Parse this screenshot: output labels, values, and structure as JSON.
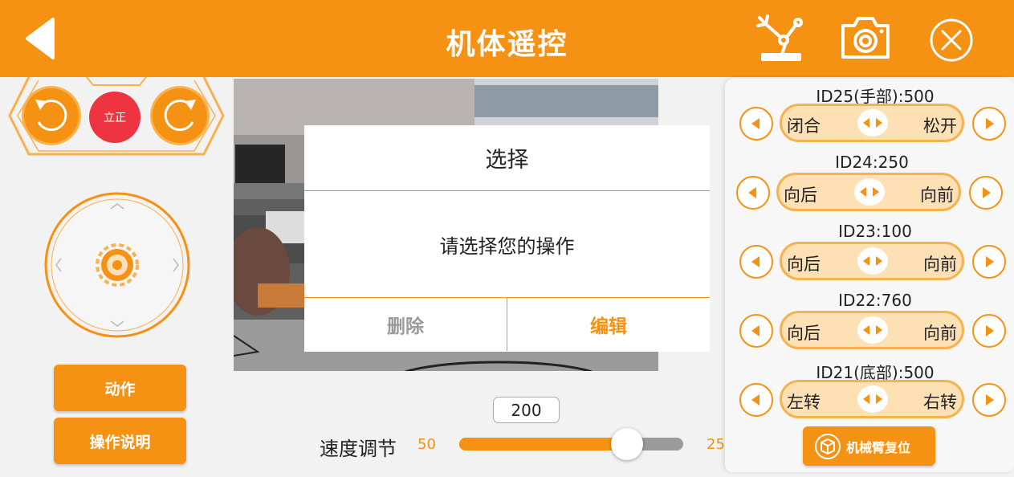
{
  "header": {
    "title": "机体遥控",
    "icons": [
      "back-arrow-icon",
      "robot-arm-icon",
      "camera-icon",
      "close-icon"
    ]
  },
  "left_panel": {
    "upright_label": "立正",
    "action_label": "动作",
    "instructions_label": "操作说明"
  },
  "dialog": {
    "title": "选择",
    "message": "请选择您的操作",
    "delete_label": "删除",
    "edit_label": "编辑"
  },
  "speed": {
    "label": "速度调节",
    "value": "200",
    "min_label": "50",
    "max_label": "25",
    "fill_fraction": 0.75
  },
  "servos": [
    {
      "label": "ID25(手部):500",
      "left": "闭合",
      "right": "松开"
    },
    {
      "label": "ID24:250",
      "left": "向后",
      "right": "向前"
    },
    {
      "label": "ID23:100",
      "left": "向后",
      "right": "向前"
    },
    {
      "label": "ID22:760",
      "left": "向后",
      "right": "向前"
    },
    {
      "label": "ID21(底部):500",
      "left": "左转",
      "right": "右转"
    }
  ],
  "reset_label": "机械臂复位",
  "colors": {
    "accent": "#f59113",
    "pill_fill": "#fde1b4",
    "stop_red": "#ee3341"
  }
}
